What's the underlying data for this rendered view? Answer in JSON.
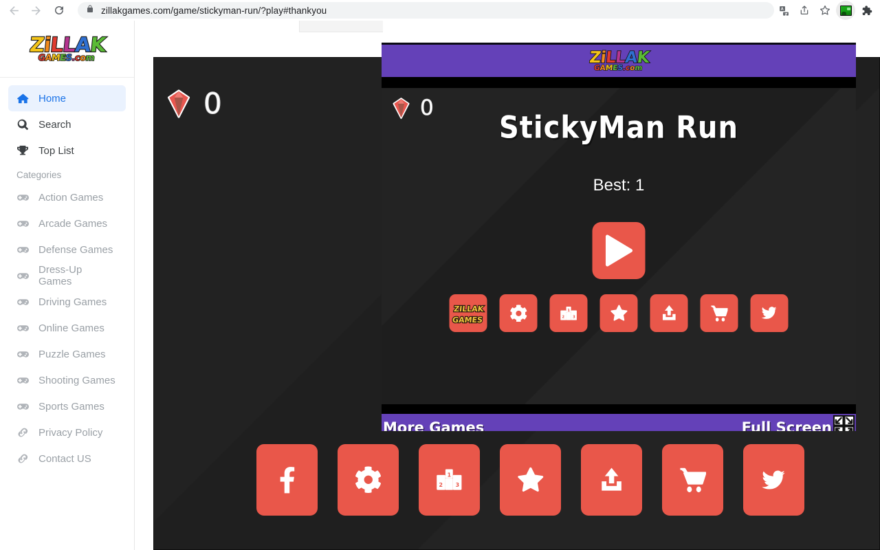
{
  "browser": {
    "url": "zillakgames.com/game/stickyman-run/?play#thankyou",
    "back_label": "Back",
    "forward_label": "Forward",
    "reload_label": "Reload",
    "lock_label": "View site information",
    "translate_label": "Translate this page",
    "share_label": "Share this page",
    "bookmark_label": "Bookmark this tab",
    "extension_label": "Extension",
    "extensions_label": "Extensions"
  },
  "sidebar": {
    "logo": {
      "main": [
        {
          "ch": "Z",
          "color": "#f5c518"
        },
        {
          "ch": "i",
          "color": "#f08a1e"
        },
        {
          "ch": "L",
          "color": "#e03a2f"
        },
        {
          "ch": "L",
          "color": "#b5358f"
        },
        {
          "ch": "A",
          "color": "#2f6fd0"
        },
        {
          "ch": "K",
          "color": "#5aba35"
        }
      ],
      "sub": [
        {
          "ch": "G",
          "color": "#e03a2f"
        },
        {
          "ch": "A",
          "color": "#f08a1e"
        },
        {
          "ch": "M",
          "color": "#f5c518"
        },
        {
          "ch": "E",
          "color": "#5aba35"
        },
        {
          "ch": "S",
          "color": "#2f6fd0"
        },
        {
          "ch": ".",
          "color": "#b5358f"
        },
        {
          "ch": "c",
          "color": "#e03a2f"
        },
        {
          "ch": "o",
          "color": "#f08a1e"
        },
        {
          "ch": "m",
          "color": "#5aba35"
        }
      ]
    },
    "items": [
      {
        "label": "Home",
        "icon": "home-icon",
        "state": "active"
      },
      {
        "label": "Search",
        "icon": "search-icon",
        "state": "normal"
      },
      {
        "label": "Top List",
        "icon": "trophy-icon",
        "state": "normal"
      }
    ],
    "category_heading": "Categories",
    "categories": [
      {
        "label": "Action Games",
        "icon": "gamepad-icon"
      },
      {
        "label": "Arcade Games",
        "icon": "gamepad-icon"
      },
      {
        "label": "Defense Games",
        "icon": "gamepad-icon"
      },
      {
        "label": "Dress-Up Games",
        "icon": "gamepad-icon"
      },
      {
        "label": "Driving Games",
        "icon": "gamepad-icon"
      },
      {
        "label": "Online Games",
        "icon": "gamepad-icon"
      },
      {
        "label": "Puzzle Games",
        "icon": "gamepad-icon"
      },
      {
        "label": "Shooting Games",
        "icon": "gamepad-icon"
      },
      {
        "label": "Sports Games",
        "icon": "gamepad-icon"
      }
    ],
    "links": [
      {
        "label": "Privacy Policy",
        "icon": "link-icon"
      },
      {
        "label": "Contact US",
        "icon": "link-icon"
      }
    ]
  },
  "page": {
    "outer_score": "0",
    "outer_icons": [
      {
        "name": "facebook-icon"
      },
      {
        "name": "gear-icon"
      },
      {
        "name": "podium-icon"
      },
      {
        "name": "star-icon"
      },
      {
        "name": "share-upload-icon"
      },
      {
        "name": "cart-icon"
      },
      {
        "name": "twitter-icon"
      }
    ]
  },
  "game": {
    "header_logo": {
      "main": [
        {
          "ch": "Z",
          "color": "#f5c518"
        },
        {
          "ch": "i",
          "color": "#f08a1e"
        },
        {
          "ch": "L",
          "color": "#e03a2f"
        },
        {
          "ch": "L",
          "color": "#b5358f"
        },
        {
          "ch": "A",
          "color": "#2f6fd0"
        },
        {
          "ch": "K",
          "color": "#5aba35"
        }
      ],
      "sub": [
        {
          "ch": "G",
          "color": "#e03a2f"
        },
        {
          "ch": "A",
          "color": "#f08a1e"
        },
        {
          "ch": "M",
          "color": "#f5c518"
        },
        {
          "ch": "E",
          "color": "#5aba35"
        },
        {
          "ch": "S",
          "color": "#2f6fd0"
        },
        {
          "ch": ".",
          "color": "#b5358f"
        },
        {
          "ch": "c",
          "color": "#e03a2f"
        },
        {
          "ch": "o",
          "color": "#f08a1e"
        },
        {
          "ch": "m",
          "color": "#5aba35"
        }
      ]
    },
    "score": "0",
    "title": "StickyMan Run",
    "best": "Best: 1",
    "play_label": "Play",
    "icons": [
      {
        "name": "zillak-logo-icon",
        "line1": "ZILLAK",
        "line2": "GAMES"
      },
      {
        "name": "gear-icon"
      },
      {
        "name": "podium-icon"
      },
      {
        "name": "star-icon"
      },
      {
        "name": "share-upload-icon"
      },
      {
        "name": "cart-icon"
      },
      {
        "name": "twitter-icon"
      }
    ],
    "footer": {
      "more_games": "More Games",
      "full_screen": "Full Screen"
    }
  },
  "colors": {
    "accent_red": "#e9574a",
    "purple": "#6441b8",
    "dark_bg": "#222222",
    "link_blue": "#1a73e8"
  }
}
